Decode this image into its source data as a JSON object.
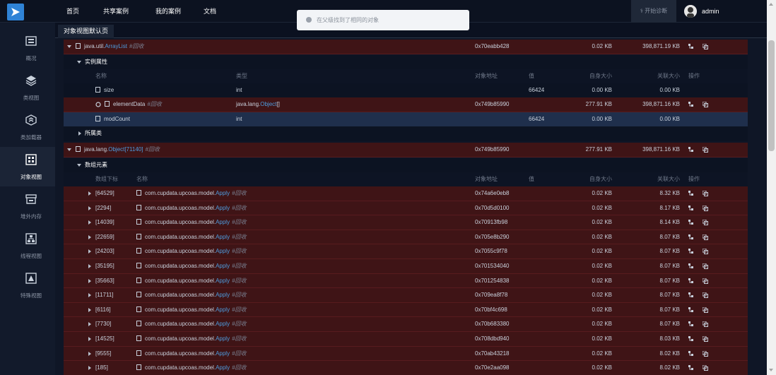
{
  "nav": {
    "items": [
      "首页",
      "共享案例",
      "我的案例",
      "文档"
    ],
    "diag_label": "开始诊断",
    "user": "admin"
  },
  "sidebar": {
    "items": [
      {
        "label": "概况",
        "icon": "overview-icon"
      },
      {
        "label": "类视图",
        "icon": "class-view-icon"
      },
      {
        "label": "类加载器",
        "icon": "classloader-icon"
      },
      {
        "label": "对象视图",
        "icon": "object-view-icon",
        "active": true
      },
      {
        "label": "堆外内存",
        "icon": "offheap-icon"
      },
      {
        "label": "线程视图",
        "icon": "thread-view-icon"
      },
      {
        "label": "特殊视图",
        "icon": "special-view-icon"
      }
    ]
  },
  "tab": {
    "label": "对象视图默认页"
  },
  "toast": {
    "message": "在父级找到了相同的对象"
  },
  "colors": {
    "accent": "#2f83d6",
    "link": "#4d9de0",
    "red_row": "#3f1416",
    "selected_row": "#1f2f4c"
  },
  "obj1": {
    "class_pre": "java.util.",
    "class_link": "ArrayList",
    "gc": "#回收",
    "addr": "0x70eabb428",
    "self": "0.02 KB",
    "retained": "398,871.19 KB"
  },
  "section_instance": "实例属性",
  "section_superclass": "所属类",
  "attr_headers": [
    "名称",
    "类型",
    "对象地址",
    "值",
    "自身大小",
    "关联大小",
    "操作"
  ],
  "attrs": [
    {
      "name": "size",
      "type_pre": "int",
      "type_link": "",
      "type_post": "",
      "addr": "",
      "value": "66424",
      "self": "0.00 KB",
      "retained": "0.00 KB",
      "actions": false
    },
    {
      "name": "elementData",
      "gc": "#回收",
      "type_pre": "java.lang.",
      "type_link": "Object",
      "type_post": "[]",
      "addr": "0x749b85990",
      "value": "",
      "self": "277.91 KB",
      "retained": "398,871.16 KB",
      "actions": true
    },
    {
      "name": "modCount",
      "type_pre": "int",
      "type_link": "",
      "type_post": "",
      "addr": "",
      "value": "66424",
      "self": "0.00 KB",
      "retained": "0.00 KB",
      "actions": false
    }
  ],
  "obj2": {
    "class_pre": "java.lang.",
    "class_link": "Object",
    "class_post": "[71140]",
    "gc": "#回收",
    "addr": "0x749b85990",
    "self": "277.91 KB",
    "retained": "398,871.16 KB"
  },
  "section_array": "数组元素",
  "array_headers": [
    "数组下标",
    "名称",
    "对象地址",
    "值",
    "自身大小",
    "关联大小",
    "操作"
  ],
  "array_rows": [
    {
      "index": "[64529]",
      "pkg": "com.cupdata.upcoas.model.",
      "cls": "Apply",
      "gc": "#回收",
      "addr": "0x74a6e0eb8",
      "self": "0.02 KB",
      "retained": "8.32 KB"
    },
    {
      "index": "[2294]",
      "pkg": "com.cupdata.upcoas.model.",
      "cls": "Apply",
      "gc": "#回收",
      "addr": "0x70d5d0100",
      "self": "0.02 KB",
      "retained": "8.17 KB"
    },
    {
      "index": "[14039]",
      "pkg": "com.cupdata.upcoas.model.",
      "cls": "Apply",
      "gc": "#回收",
      "addr": "0x70913fb98",
      "self": "0.02 KB",
      "retained": "8.14 KB"
    },
    {
      "index": "[22659]",
      "pkg": "com.cupdata.upcoas.model.",
      "cls": "Apply",
      "gc": "#回收",
      "addr": "0x705e8b290",
      "self": "0.02 KB",
      "retained": "8.07 KB"
    },
    {
      "index": "[24203]",
      "pkg": "com.cupdata.upcoas.model.",
      "cls": "Apply",
      "gc": "#回收",
      "addr": "0x7055c9f78",
      "self": "0.02 KB",
      "retained": "8.07 KB"
    },
    {
      "index": "[35195]",
      "pkg": "com.cupdata.upcoas.model.",
      "cls": "Apply",
      "gc": "#回收",
      "addr": "0x701534040",
      "self": "0.02 KB",
      "retained": "8.07 KB"
    },
    {
      "index": "[35663]",
      "pkg": "com.cupdata.upcoas.model.",
      "cls": "Apply",
      "gc": "#回收",
      "addr": "0x701254838",
      "self": "0.02 KB",
      "retained": "8.07 KB"
    },
    {
      "index": "[11711]",
      "pkg": "com.cupdata.upcoas.model.",
      "cls": "Apply",
      "gc": "#回收",
      "addr": "0x709ea8f78",
      "self": "0.02 KB",
      "retained": "8.07 KB"
    },
    {
      "index": "[6116]",
      "pkg": "com.cupdata.upcoas.model.",
      "cls": "Apply",
      "gc": "#回收",
      "addr": "0x70bf4c698",
      "self": "0.02 KB",
      "retained": "8.07 KB"
    },
    {
      "index": "[7730]",
      "pkg": "com.cupdata.upcoas.model.",
      "cls": "Apply",
      "gc": "#回收",
      "addr": "0x70b683380",
      "self": "0.02 KB",
      "retained": "8.07 KB"
    },
    {
      "index": "[14525]",
      "pkg": "com.cupdata.upcoas.model.",
      "cls": "Apply",
      "gc": "#回收",
      "addr": "0x708dbd940",
      "self": "0.02 KB",
      "retained": "8.03 KB"
    },
    {
      "index": "[9555]",
      "pkg": "com.cupdata.upcoas.model.",
      "cls": "Apply",
      "gc": "#回收",
      "addr": "0x70ab43218",
      "self": "0.02 KB",
      "retained": "8.02 KB"
    },
    {
      "index": "[185]",
      "pkg": "com.cupdata.upcoas.model.",
      "cls": "Apply",
      "gc": "#回收",
      "addr": "0x70e2aa098",
      "self": "0.02 KB",
      "retained": "8.02 KB"
    }
  ]
}
